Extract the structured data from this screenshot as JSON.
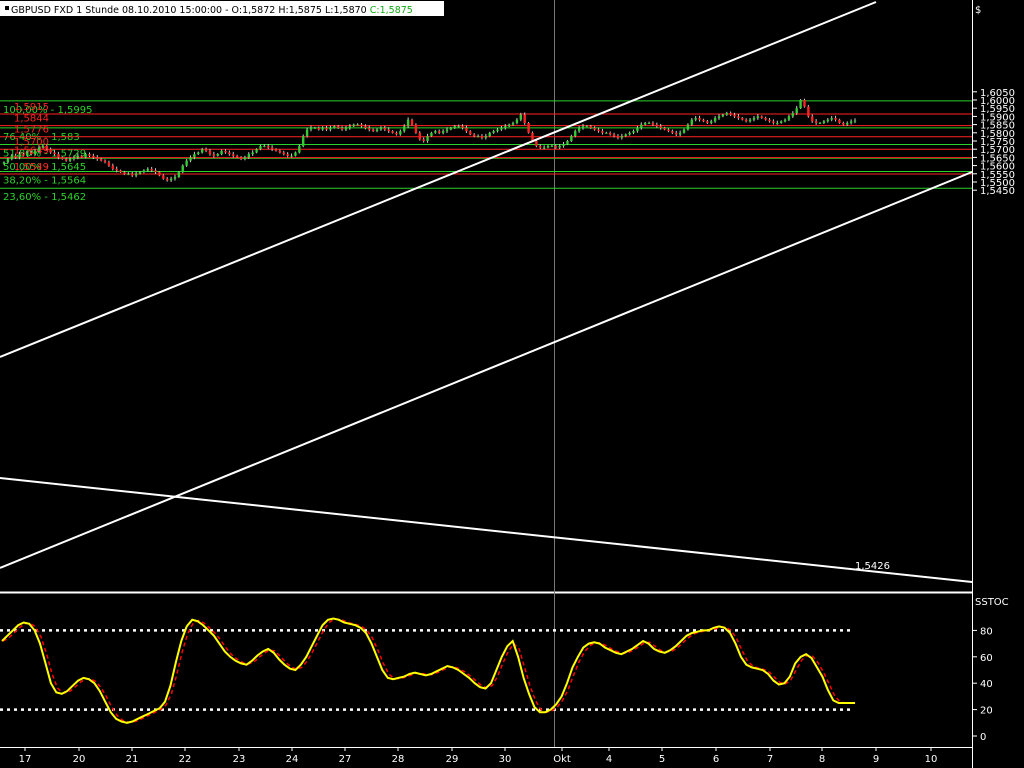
{
  "header": {
    "text": "GBPUSD FXD  1 Stunde   08.10.2010  15:00:00 - O:",
    "open": "1,5872",
    "high_label": "H:",
    "high": "1,5875",
    "low_label": "L:",
    "low": "1,5870",
    "close_label": "C:",
    "close": "1,5875"
  },
  "colors": {
    "background": "#000000",
    "bull": "#33cc33",
    "bear": "#ff2222",
    "fib": "#2bd22b",
    "level": "#ff2222",
    "channel": "#ffffff",
    "stoch_k": "#ffff00",
    "stoch_d": "#ff0000",
    "axis_text": "#ffffff",
    "grid": "#444444"
  },
  "chart_data": [
    {
      "type": "candlestick",
      "title": "GBPUSD FXD 1 Stunde",
      "currency_label": "$",
      "ylim": [
        1.5405,
        1.6105
      ],
      "y_ticks": [
        "1,6050",
        "1,6000",
        "1,5950",
        "1,5900",
        "1,5850",
        "1,5800",
        "1,5750",
        "1,5700",
        "1,5650",
        "1,5600",
        "1,5550",
        "1,5500",
        "1,5450"
      ],
      "x_ticks": [
        "17",
        "20",
        "21",
        "22",
        "23",
        "24",
        "27",
        "28",
        "29",
        "30",
        "Okt",
        "4",
        "5",
        "6",
        "7",
        "8",
        "9",
        "10"
      ],
      "fib_levels": [
        {
          "label": "100,00% - 1,5995",
          "value": 1.5995
        },
        {
          "label": "76,40% - 1,583",
          "value": 1.583
        },
        {
          "label": "51,80% - 1,5729",
          "value": 1.5729
        },
        {
          "label": "50,00% - 1,5645",
          "value": 1.5645
        },
        {
          "label": "38,20% - 1,5564",
          "value": 1.5564
        },
        {
          "label": "23,60% - 1,5462",
          "value": 1.5462
        }
      ],
      "price_levels": [
        {
          "label": "1,5915",
          "value": 1.5915
        },
        {
          "label": "1,5844",
          "value": 1.5844
        },
        {
          "label": "1,5776",
          "value": 1.5776
        },
        {
          "label": "1,5700",
          "value": 1.57
        },
        {
          "label": "1,5649",
          "value": 1.5649
        },
        {
          "label": "1,5549",
          "value": 1.5549
        }
      ],
      "trendline_annotation": "1,5426",
      "hourly_closes": [
        1.562,
        1.564,
        1.566,
        1.565,
        1.567,
        1.566,
        1.568,
        1.567,
        1.569,
        1.571,
        1.572,
        1.57,
        1.568,
        1.567,
        1.565,
        1.564,
        1.563,
        1.564,
        1.565,
        1.566,
        1.565,
        1.567,
        1.566,
        1.565,
        1.564,
        1.563,
        1.562,
        1.56,
        1.558,
        1.557,
        1.556,
        1.555,
        1.555,
        1.554,
        1.555,
        1.556,
        1.557,
        1.558,
        1.557,
        1.556,
        1.554,
        1.552,
        1.551,
        1.552,
        1.553,
        1.556,
        1.56,
        1.563,
        1.565,
        1.567,
        1.568,
        1.57,
        1.569,
        1.567,
        1.566,
        1.567,
        1.569,
        1.568,
        1.567,
        1.566,
        1.565,
        1.564,
        1.565,
        1.567,
        1.568,
        1.57,
        1.572,
        1.572,
        1.571,
        1.57,
        1.569,
        1.568,
        1.567,
        1.566,
        1.566,
        1.568,
        1.572,
        1.578,
        1.582,
        1.583,
        1.583,
        1.582,
        1.583,
        1.582,
        1.583,
        1.584,
        1.583,
        1.582,
        1.583,
        1.584,
        1.585,
        1.585,
        1.584,
        1.583,
        1.582,
        1.581,
        1.582,
        1.583,
        1.582,
        1.581,
        1.58,
        1.579,
        1.581,
        1.584,
        1.588,
        1.585,
        1.58,
        1.576,
        1.575,
        1.578,
        1.58,
        1.581,
        1.58,
        1.581,
        1.582,
        1.583,
        1.584,
        1.584,
        1.583,
        1.581,
        1.579,
        1.578,
        1.578,
        1.577,
        1.578,
        1.58,
        1.581,
        1.582,
        1.583,
        1.584,
        1.585,
        1.586,
        1.588,
        1.591,
        1.586,
        1.58,
        1.575,
        1.572,
        1.571,
        1.571,
        1.572,
        1.572,
        1.571,
        1.572,
        1.573,
        1.575,
        1.578,
        1.581,
        1.583,
        1.584,
        1.584,
        1.583,
        1.582,
        1.581,
        1.58,
        1.58,
        1.579,
        1.578,
        1.577,
        1.578,
        1.579,
        1.58,
        1.581,
        1.583,
        1.585,
        1.586,
        1.586,
        1.585,
        1.584,
        1.583,
        1.582,
        1.581,
        1.58,
        1.579,
        1.58,
        1.582,
        1.585,
        1.588,
        1.589,
        1.588,
        1.587,
        1.586,
        1.587,
        1.589,
        1.59,
        1.591,
        1.592,
        1.591,
        1.59,
        1.589,
        1.588,
        1.587,
        1.588,
        1.589,
        1.59,
        1.589,
        1.588,
        1.587,
        1.586,
        1.586,
        1.587,
        1.588,
        1.59,
        1.592,
        1.595,
        1.6,
        1.596,
        1.59,
        1.587,
        1.586,
        1.586,
        1.587,
        1.588,
        1.589,
        1.588,
        1.586,
        1.585,
        1.586,
        1.587,
        1.5875
      ]
    },
    {
      "type": "line",
      "title": "SSTOC",
      "ylim": [
        -5,
        100
      ],
      "y_ticks": [
        "80",
        "60",
        "40",
        "20",
        "0"
      ],
      "bands": [
        80,
        20
      ],
      "series": [
        {
          "values": [
            72,
            76,
            80,
            84,
            86,
            85,
            80,
            70,
            55,
            40,
            33,
            32,
            34,
            38,
            42,
            44,
            43,
            40,
            34,
            26,
            18,
            13,
            11,
            10,
            11,
            13,
            15,
            17,
            19,
            21,
            26,
            38,
            56,
            72,
            83,
            88,
            87,
            84,
            80,
            76,
            70,
            64,
            60,
            57,
            55,
            54,
            57,
            61,
            64,
            66,
            63,
            58,
            54,
            51,
            50,
            54,
            60,
            68,
            76,
            84,
            88,
            89,
            88,
            86,
            85,
            84,
            82,
            78,
            70,
            60,
            50,
            44,
            43,
            44,
            45,
            47,
            48,
            47,
            46,
            47,
            49,
            51,
            53,
            52,
            50,
            47,
            44,
            40,
            37,
            36,
            40,
            50,
            60,
            68,
            72,
            60,
            44,
            32,
            22,
            18,
            18,
            20,
            24,
            30,
            40,
            52,
            60,
            67,
            70,
            71,
            70,
            67,
            65,
            63,
            62,
            64,
            66,
            69,
            72,
            70,
            66,
            64,
            63,
            65,
            68,
            72,
            76,
            78,
            79,
            80,
            80,
            82,
            83,
            82,
            78,
            70,
            60,
            54,
            52,
            51,
            50,
            47,
            42,
            39,
            40,
            45,
            55,
            60,
            62,
            59,
            52,
            45,
            35,
            27,
            25,
            25,
            25,
            25
          ]
        }
      ]
    }
  ]
}
